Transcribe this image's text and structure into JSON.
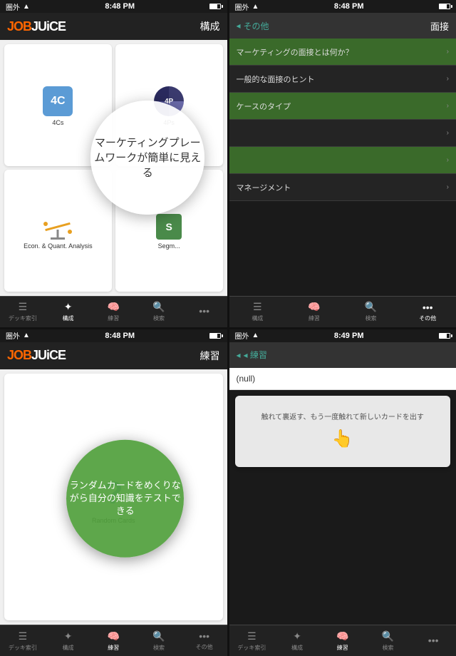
{
  "screens": {
    "s1": {
      "status": {
        "left": "圏外",
        "center": "8:48 PM",
        "signal": "▲",
        "time_label": "8:48 PM"
      },
      "header": {
        "logo_job": "JOB",
        "logo_juice": "JUiCE",
        "title": "構成"
      },
      "cards": [
        {
          "id": "4cs",
          "icon_text": "4C",
          "label": "4Cs"
        },
        {
          "id": "4ps",
          "icon_text": "4P",
          "label": "4Ps"
        },
        {
          "id": "econ",
          "label": "Econ. & Quant. Analysis"
        },
        {
          "id": "seg",
          "icon_text": "S",
          "label": "Segm..."
        }
      ],
      "tabs": [
        {
          "id": "deck",
          "icon": "☰",
          "label": "デッキ索引",
          "active": false
        },
        {
          "id": "structure",
          "icon": "✦",
          "label": "構成",
          "active": true
        },
        {
          "id": "practice",
          "icon": "🧠",
          "label": "練習",
          "active": false
        },
        {
          "id": "search",
          "icon": "🔍",
          "label": "検索",
          "active": false
        },
        {
          "id": "more",
          "icon": "•••",
          "label": "",
          "active": false
        }
      ],
      "bubble_text": "マーケティングプレームワークが簡単に見える"
    },
    "s2": {
      "status": {
        "left": "圏外",
        "center": "8:48 PM"
      },
      "header": {
        "back": "◂ その他",
        "title": "面接"
      },
      "items": [
        {
          "text": "マーケティングの面接とは何か？",
          "green": true
        },
        {
          "text": "一般的な面接のヒント",
          "green": false
        },
        {
          "text": "ケースのタイプ",
          "green": true
        },
        {
          "text": "",
          "green": false
        },
        {
          "text": "",
          "green": true
        },
        {
          "text": "マネージメント",
          "green": false
        }
      ],
      "tabs": [
        {
          "id": "deck",
          "icon": "☰",
          "label": "構成",
          "active": false
        },
        {
          "id": "practice",
          "icon": "🧠",
          "label": "練習",
          "active": false
        },
        {
          "id": "search",
          "icon": "🔍",
          "label": "検索",
          "active": false
        },
        {
          "id": "more",
          "icon": "•••",
          "label": "その他",
          "active": true
        }
      ]
    },
    "s3": {
      "status": {
        "left": "圏外",
        "center": "8:48 PM"
      },
      "header": {
        "logo_job": "JOB",
        "logo_juice": "JUiCE",
        "title": "練習"
      },
      "card_label": "Random Cards",
      "tabs": [
        {
          "id": "deck",
          "icon": "☰",
          "label": "デッキ索引",
          "active": false
        },
        {
          "id": "structure",
          "icon": "✦",
          "label": "構成",
          "active": false
        },
        {
          "id": "practice",
          "icon": "🧠",
          "label": "練習",
          "active": true
        },
        {
          "id": "search",
          "icon": "🔍",
          "label": "検索",
          "active": false
        },
        {
          "id": "more",
          "icon": "•••",
          "label": "その他",
          "active": false
        }
      ],
      "bubble_text": "ランダムカードをめくりながら自分の知識をテストできる"
    },
    "s4": {
      "status": {
        "left": "圏外",
        "center": "8:49 PM"
      },
      "header": {
        "back": "◂ 練習"
      },
      "null_text": "(null)",
      "swipe_text": "触れて裏返す、もう一度触れて新しいカードを出す",
      "tabs": [
        {
          "id": "deck",
          "icon": "☰",
          "label": "デッキ索引",
          "active": false
        },
        {
          "id": "structure",
          "icon": "✦",
          "label": "構成",
          "active": false
        },
        {
          "id": "practice",
          "icon": "🧠",
          "label": "練習",
          "active": true
        },
        {
          "id": "search",
          "icon": "🔍",
          "label": "検索",
          "active": false
        },
        {
          "id": "more",
          "icon": "•••",
          "label": "",
          "active": false
        }
      ]
    }
  }
}
